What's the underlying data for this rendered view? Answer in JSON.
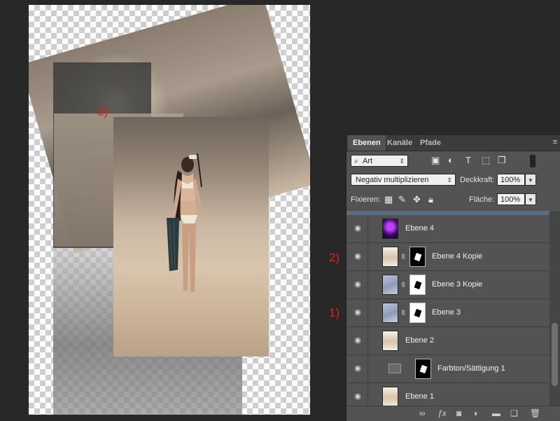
{
  "annotations": [
    "3)",
    "2)",
    "1)"
  ],
  "panel": {
    "tabs": [
      "Ebenen",
      "Kanäle",
      "Pfade"
    ],
    "menu_icon": "≡",
    "filter_kind": "Art",
    "blend_mode": "Negativ multiplizieren",
    "opacity_label": "Deckkraft:",
    "opacity_value": "100%",
    "lock_label": "Fixieren:",
    "fill_label": "Fläche:",
    "fill_value": "100%",
    "layers": [
      {
        "name": "Ebene 4",
        "thumb": "purple",
        "mask": false
      },
      {
        "name": "Ebene 4 Kopie",
        "thumb": "woman",
        "mask": true
      },
      {
        "name": "Ebene 3 Kopie",
        "thumb": "sky",
        "mask": true
      },
      {
        "name": "Ebene 3",
        "thumb": "sky",
        "mask": true
      },
      {
        "name": "Ebene 2",
        "thumb": "woman",
        "mask": false
      },
      {
        "name": "Farbton/Sättigung 1",
        "thumb": "adjust",
        "mask": true
      },
      {
        "name": "Ebene 1",
        "thumb": "woman",
        "mask": false
      }
    ]
  },
  "colors": {
    "annotation": "#e0201c",
    "panel_bg": "#535353"
  }
}
